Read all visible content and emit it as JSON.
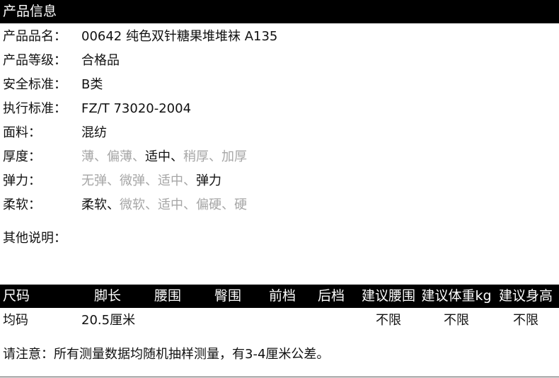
{
  "info": {
    "header": "产品信息",
    "rows": [
      {
        "label": "产品品名：",
        "value": "00642 纯色双针糖果堆堆袜 A135"
      },
      {
        "label": "产品等级：",
        "value": "合格品"
      },
      {
        "label": "安全标准：",
        "value": "B类"
      },
      {
        "label": "执行标准：",
        "value": "FZ/T 73020-2004"
      },
      {
        "label": "面料：",
        "value": "混纺"
      }
    ],
    "scales": [
      {
        "label": "厚度：",
        "options": [
          "薄",
          "偏薄",
          "适中",
          "稍厚",
          "加厚"
        ],
        "selected": "适中"
      },
      {
        "label": "弹力：",
        "options": [
          "无弹",
          "微弹",
          "适中",
          "弹力"
        ],
        "selected": "弹力"
      },
      {
        "label": "柔软：",
        "options": [
          "柔软",
          "微软",
          "适中",
          "偏硬",
          "硬"
        ],
        "selected": "柔软"
      }
    ],
    "other_label": "其他说明："
  },
  "size_table": {
    "headers": [
      "尺码",
      "脚长",
      "腰围",
      "臀围",
      "前档",
      "后档",
      "建议腰围",
      "建议体重kg",
      "建议身高"
    ],
    "rows": [
      [
        "均码",
        "20.5厘米",
        "",
        "",
        "",
        "",
        "不限",
        "不限",
        "不限"
      ]
    ]
  },
  "note": "请注意：所有测量数据均随机抽样测量，有3-4厘米公差。",
  "colors": {
    "bar_bg": "#000000",
    "bar_text": "#ffffff",
    "muted": "#a6a6a6",
    "text": "#111111"
  }
}
